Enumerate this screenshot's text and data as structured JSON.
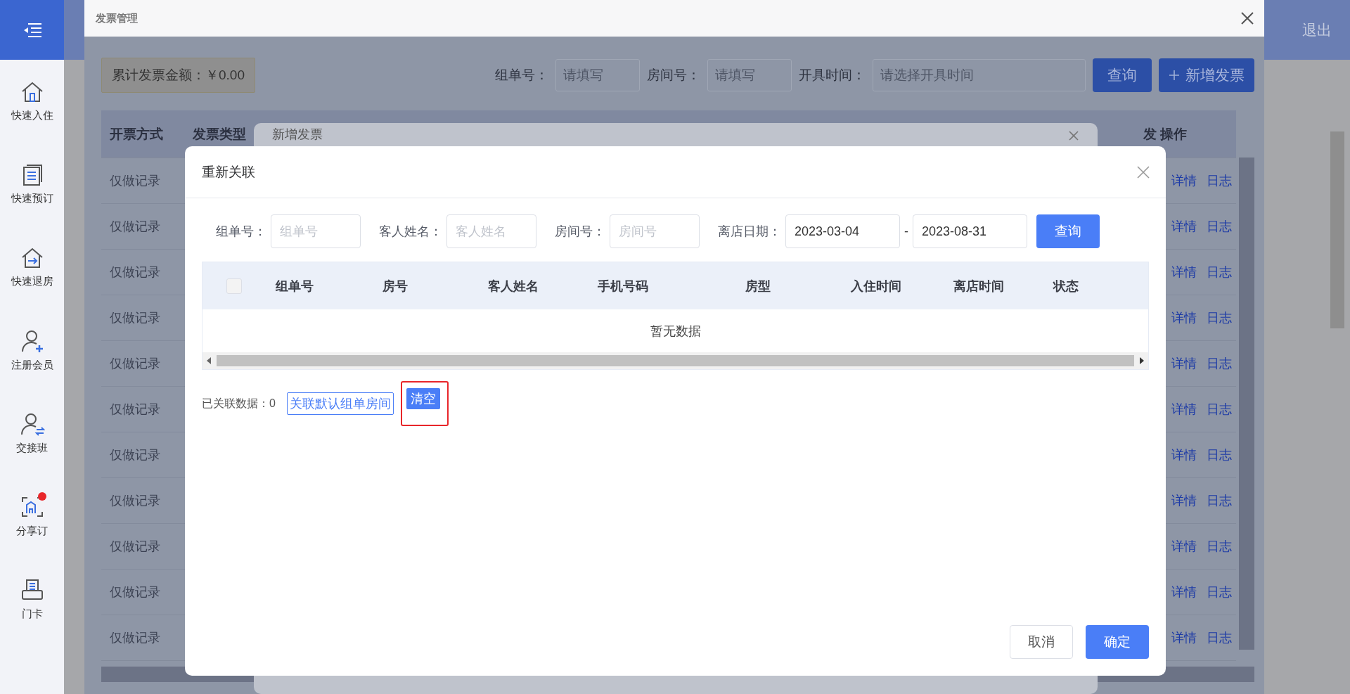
{
  "sidebar": {
    "items": [
      {
        "label": "快速入住",
        "kind": "home",
        "dot": false
      },
      {
        "label": "快速预订",
        "kind": "list",
        "dot": false
      },
      {
        "label": "快速退房",
        "kind": "exit",
        "dot": false
      },
      {
        "label": "注册会员",
        "kind": "add-user",
        "dot": false
      },
      {
        "label": "交接班",
        "kind": "swap-user",
        "dot": false
      },
      {
        "label": "分享订",
        "kind": "scan",
        "dot": true
      },
      {
        "label": "门卡",
        "kind": "printer",
        "dot": false
      }
    ]
  },
  "top_bar": {
    "logout": "退出"
  },
  "invoice_window": {
    "title": "发票管理",
    "total": "累计发票金额：￥0.00",
    "filters": [
      {
        "label": "组单号：",
        "placeholder": "请填写",
        "kind": "short"
      },
      {
        "label": "房间号：",
        "placeholder": "请填写",
        "kind": "short"
      },
      {
        "label": "开具时间：",
        "placeholder": "请选择开具时间",
        "kind": "long"
      }
    ],
    "query_button": "查询",
    "add_button": "新增发票",
    "table": {
      "columns": [
        "开票方式",
        "发票类型",
        "发",
        "操作"
      ],
      "rows": [
        {
          "method": "仅做记录",
          "actions": [
            "详情",
            "日志"
          ]
        },
        {
          "method": "仅做记录",
          "actions": [
            "详情",
            "日志"
          ]
        },
        {
          "method": "仅做记录",
          "actions": [
            "详情",
            "日志"
          ]
        },
        {
          "method": "仅做记录",
          "actions": [
            "详情",
            "日志"
          ]
        },
        {
          "method": "仅做记录",
          "actions": [
            "详情",
            "日志"
          ]
        },
        {
          "method": "仅做记录",
          "actions": [
            "详情",
            "日志"
          ]
        },
        {
          "method": "仅做记录",
          "actions": [
            "详情",
            "日志"
          ]
        },
        {
          "method": "仅做记录",
          "actions": [
            "详情",
            "日志"
          ]
        },
        {
          "method": "仅做记录",
          "actions": [
            "详情",
            "日志"
          ]
        },
        {
          "method": "仅做记录",
          "actions": [
            "详情",
            "日志"
          ]
        },
        {
          "method": "仅做记录",
          "actions": [
            "详情",
            "日志"
          ]
        }
      ]
    }
  },
  "add_dialog": {
    "title": "新增发票"
  },
  "relink_dialog": {
    "title": "重新关联",
    "filters": [
      {
        "label": "组单号：",
        "placeholder": "组单号"
      },
      {
        "label": "客人姓名：",
        "placeholder": "客人姓名"
      },
      {
        "label": "房间号：",
        "placeholder": "房间号"
      }
    ],
    "date_label": "离店日期：",
    "date_from": "2023-03-04",
    "date_separator": "-",
    "date_to": "2023-08-31",
    "query_button": "查询",
    "table": {
      "select_all_checked": false,
      "columns": [
        "组单号",
        "房号",
        "客人姓名",
        "手机号码",
        "房型",
        "入住时间",
        "离店时间",
        "状态"
      ],
      "empty_text": "暂无数据"
    },
    "linked_text": "已关联数据：0",
    "link_default_button": "关联默认组单房间",
    "clear_button": "清空",
    "clear_highlighted": true,
    "cancel_button": "取消",
    "confirm_button": "确定"
  }
}
